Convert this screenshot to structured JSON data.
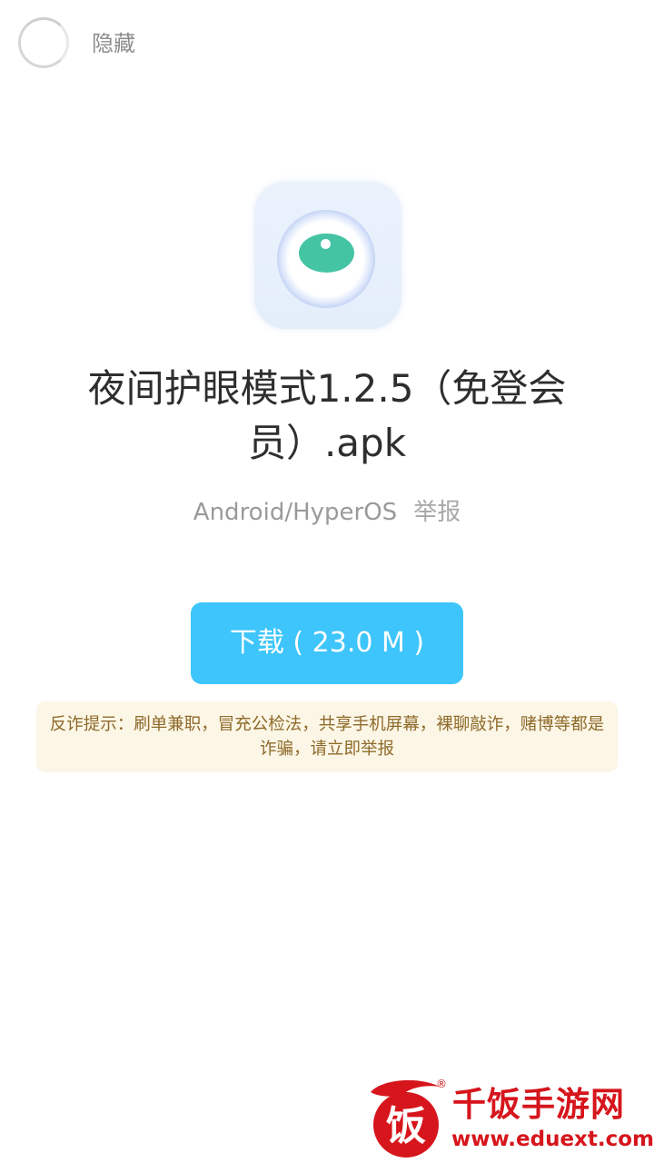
{
  "colors": {
    "accent": "#3ec5fb",
    "warning_bg": "#fcf6e6",
    "warning_text": "#8e6a2a",
    "brand_red": "#d6151c"
  },
  "topbar": {
    "toggle_icon": "circle-toggle-icon",
    "hide_label": "隐藏"
  },
  "app": {
    "icon": "eye-icon",
    "title": "夜间护眼模式1.2.5（免登会员）.apk",
    "platform": "Android/HyperOS",
    "report_label": "举报"
  },
  "download": {
    "label": "下载 ( 23.0 M )"
  },
  "warning": {
    "text": "反诈提示：刷单兼职，冒充公检法，共享手机屏幕，裸聊敲诈，赌博等都是诈骗，请立即举报"
  },
  "watermark": {
    "logo_char": "饭",
    "name": "千饭手游网",
    "url": "www.eduext.com",
    "reg_mark": "®"
  }
}
